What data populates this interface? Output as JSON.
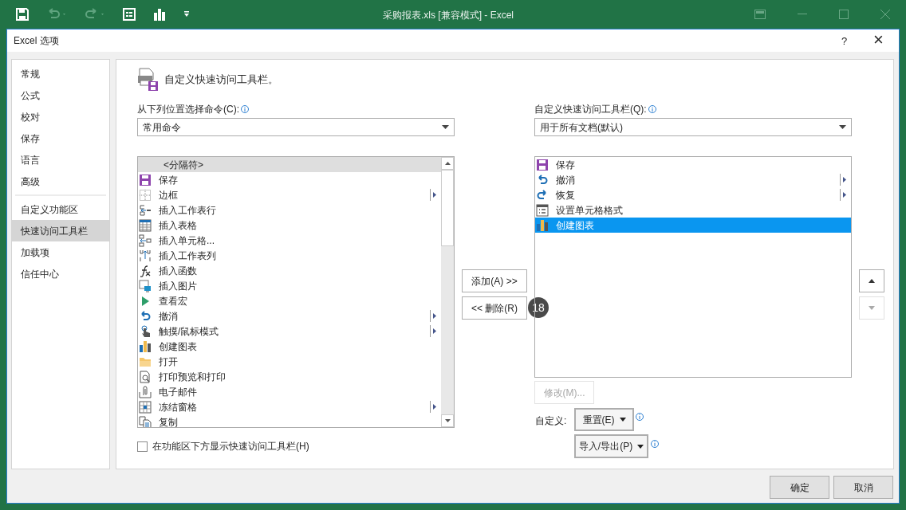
{
  "app_window": {
    "title": "采购报表.xls  [兼容模式] - Excel"
  },
  "dialog": {
    "title": "Excel 选项",
    "help": "?",
    "close": "×"
  },
  "sidebar": {
    "groups": [
      [
        {
          "label": "常规",
          "selected": false
        },
        {
          "label": "公式",
          "selected": false
        },
        {
          "label": "校对",
          "selected": false
        },
        {
          "label": "保存",
          "selected": false
        },
        {
          "label": "语言",
          "selected": false
        },
        {
          "label": "高级",
          "selected": false
        }
      ],
      [
        {
          "label": "自定义功能区",
          "selected": false
        },
        {
          "label": "快速访问工具栏",
          "selected": true
        },
        {
          "label": "加载项",
          "selected": false
        },
        {
          "label": "信任中心",
          "selected": false
        }
      ]
    ]
  },
  "heading": "自定义快速访问工具栏。",
  "commands_from": {
    "label": "从下列位置选择命令(C):",
    "value": "常用命令"
  },
  "commands_list": [
    {
      "label": "<分隔符>",
      "selected": true,
      "submenu": false,
      "kind": "separator"
    },
    {
      "label": "保存",
      "selected": false,
      "submenu": false,
      "kind": "save"
    },
    {
      "label": "边框",
      "selected": false,
      "submenu": true,
      "kind": "border"
    },
    {
      "label": "插入工作表行",
      "selected": false,
      "submenu": false,
      "kind": "rows"
    },
    {
      "label": "插入表格",
      "selected": false,
      "submenu": false,
      "kind": "table"
    },
    {
      "label": "插入单元格...",
      "selected": false,
      "submenu": false,
      "kind": "cells"
    },
    {
      "label": "插入工作表列",
      "selected": false,
      "submenu": false,
      "kind": "columns"
    },
    {
      "label": "插入函数",
      "selected": false,
      "submenu": false,
      "kind": "function"
    },
    {
      "label": "插入图片",
      "selected": false,
      "submenu": false,
      "kind": "picture"
    },
    {
      "label": "查看宏",
      "selected": false,
      "submenu": false,
      "kind": "play"
    },
    {
      "label": "撤消",
      "selected": false,
      "submenu": true,
      "kind": "undo"
    },
    {
      "label": "触摸/鼠标模式",
      "selected": false,
      "submenu": true,
      "kind": "touch"
    },
    {
      "label": "创建图表",
      "selected": false,
      "submenu": false,
      "kind": "chart"
    },
    {
      "label": "打开",
      "selected": false,
      "submenu": false,
      "kind": "folder"
    },
    {
      "label": "打印预览和打印",
      "selected": false,
      "submenu": false,
      "kind": "preview"
    },
    {
      "label": "电子邮件",
      "selected": false,
      "submenu": false,
      "kind": "mail"
    },
    {
      "label": "冻结窗格",
      "selected": false,
      "submenu": true,
      "kind": "freeze"
    },
    {
      "label": "复制",
      "selected": false,
      "submenu": false,
      "kind": "copy"
    }
  ],
  "show_below_ribbon": {
    "label": "在功能区下方显示快速访问工具栏(H)",
    "checked": false
  },
  "add_button": "添加(A) >>",
  "remove_button": "<< 删除(R)",
  "step_marker": "18",
  "toolbar_for": {
    "label": "自定义快速访问工具栏(Q):",
    "value": "用于所有文档(默认)"
  },
  "toolbar_list": [
    {
      "label": "保存",
      "selected": false,
      "submenu": false,
      "kind": "save"
    },
    {
      "label": "撤消",
      "selected": false,
      "submenu": true,
      "kind": "undo"
    },
    {
      "label": "恢复",
      "selected": false,
      "submenu": true,
      "kind": "redo"
    },
    {
      "label": "设置单元格格式",
      "selected": false,
      "submenu": false,
      "kind": "format"
    },
    {
      "label": "创建图表",
      "selected": true,
      "submenu": false,
      "kind": "chart"
    }
  ],
  "modify_button": {
    "label": "修改(M)...",
    "disabled": true
  },
  "customize_label": "自定义:",
  "reset_button": "重置(E)",
  "import_export_button": "导入/导出(P)",
  "ok_button": "确定",
  "cancel_button": "取消"
}
